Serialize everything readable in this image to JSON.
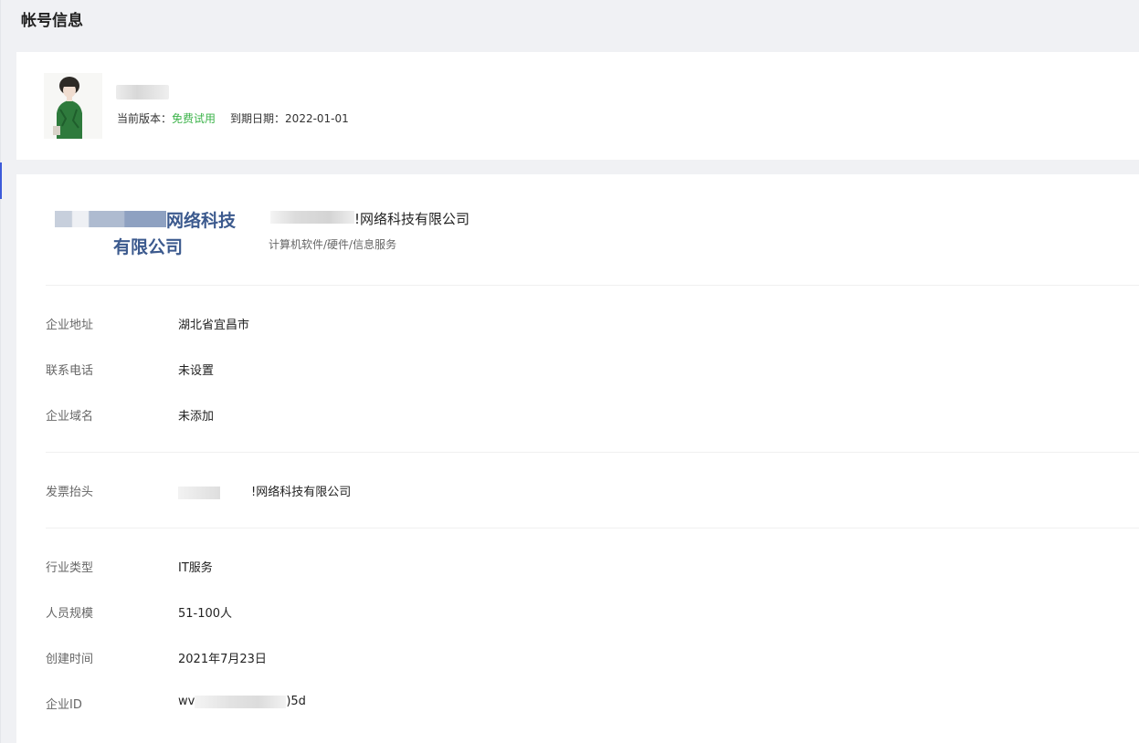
{
  "page": {
    "title": "帐号信息"
  },
  "user": {
    "version_label": "当前版本：",
    "version_value": "免费试用",
    "expire_label": "到期日期：",
    "expire_value": "2022-01-01"
  },
  "enterprise": {
    "logo_line1": "网络科技",
    "logo_line2": "有限公司",
    "name_suffix": "!网络科技有限公司",
    "category": "计算机软件/硬件/信息服务",
    "fields": [
      {
        "label": "企业地址",
        "value": "湖北省宜昌市"
      },
      {
        "label": "联系电话",
        "value": "未设置"
      },
      {
        "label": "企业域名",
        "value": "未添加"
      },
      {
        "label": "发票抬头",
        "value": "!网络科技有限公司"
      },
      {
        "label": "行业类型",
        "value": "IT服务"
      },
      {
        "label": "人员规模",
        "value": "51-100人"
      },
      {
        "label": "创建时间",
        "value": "2021年7月23日"
      },
      {
        "label": "企业ID",
        "value_prefix": "wv",
        "value_suffix": ")5d"
      }
    ]
  }
}
